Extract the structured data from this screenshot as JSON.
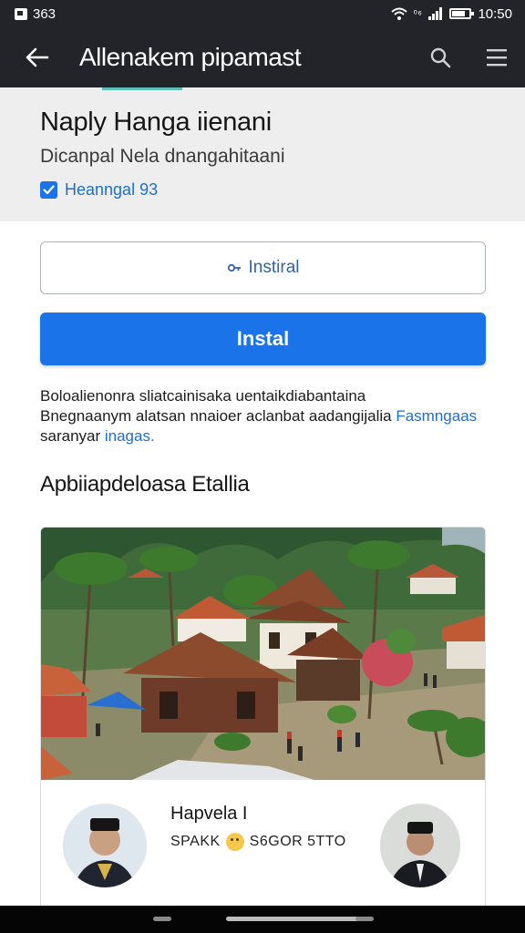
{
  "status_bar": {
    "left_text": "363",
    "right_small": "⁰⁶",
    "time": "10:50"
  },
  "app_bar": {
    "title": "Allenakem pipamast",
    "icons": [
      "back-arrow-icon",
      "search-icon",
      "menu-icon"
    ]
  },
  "header": {
    "app_name": "Naply Hanga iienani",
    "developer": "Dicanpal  Nela dnangahitaani",
    "badge_label": "Heanngal 93"
  },
  "buttons": {
    "secondary_label": "Instiral",
    "primary_label": "Instal"
  },
  "description": {
    "line1": "Boloalienonra sliatcainisaka uentaikdiabantaina",
    "line2_text": "Bnegnaanym alatsan nnaioer aclanbat aadangijalia",
    "line2_link": " Fasmngaas",
    "line3_text": "saranyar",
    "line3_link": " inagas."
  },
  "section": {
    "title": "Apbiiapdeloasa Etallia"
  },
  "card": {
    "name": "Hapvela I",
    "meta_left": "SPAKK",
    "meta_right": "S6GOR 5TTO"
  },
  "colors": {
    "accent": "#1a73e8",
    "app_bar": "#22242a",
    "header_bg": "#eeeeef",
    "link": "#1a6fd1",
    "tab_indicator": "#5cc0b4"
  }
}
